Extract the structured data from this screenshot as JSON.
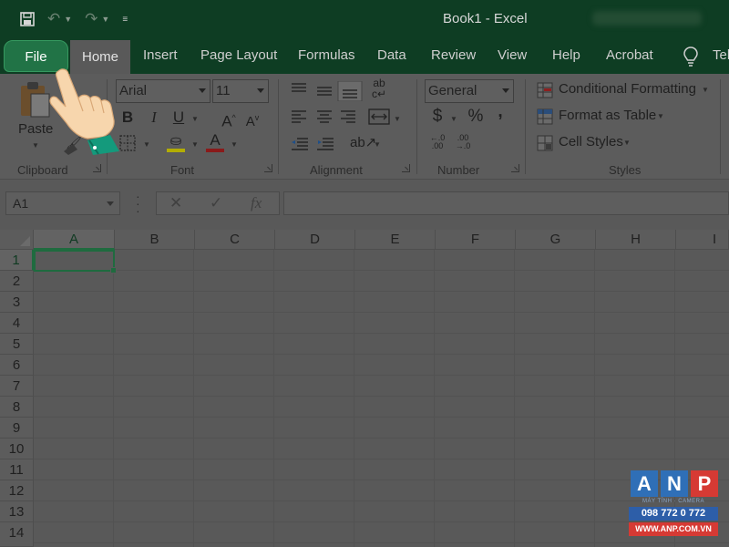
{
  "title_bar": {
    "title": "Book1  -  Excel",
    "qat": {
      "save_icon": "save-icon",
      "undo_icon": "undo-icon",
      "redo_icon": "redo-icon",
      "customize_icon": "customize-qat-icon"
    }
  },
  "tabs": {
    "file": "File",
    "home": "Home",
    "items": [
      "Insert",
      "Page Layout",
      "Formulas",
      "Data",
      "Review",
      "View",
      "Help",
      "Acrobat"
    ],
    "tell_me": "Tel",
    "tell_me_icon": "lightbulb-icon"
  },
  "ribbon": {
    "clipboard": {
      "paste_label": "Paste",
      "group_label": "Clipboard"
    },
    "font": {
      "font_name": "Arial",
      "font_size": "11",
      "bold": "B",
      "italic": "I",
      "underline": "U",
      "grow": "A",
      "shrink": "A",
      "group_label": "Font",
      "fill_color": "#e7e100",
      "font_color": "#c00000"
    },
    "alignment": {
      "group_label": "Alignment"
    },
    "number": {
      "format": "General",
      "currency": "$",
      "percent": "%",
      "comma": ",",
      "group_label": "Number"
    },
    "styles": {
      "conditional_formatting": "Conditional Formatting",
      "format_as_table": "Format as Table",
      "cell_styles": "Cell Styles",
      "group_label": "Styles"
    }
  },
  "formula_bar": {
    "name_box": "A1",
    "cancel": "✕",
    "enter": "✓",
    "fx": "fx",
    "formula": ""
  },
  "grid": {
    "columns": [
      "A",
      "B",
      "C",
      "D",
      "E",
      "F",
      "G",
      "H",
      "I"
    ],
    "rows": [
      "1",
      "2",
      "3",
      "4",
      "5",
      "6",
      "7",
      "8",
      "9",
      "10",
      "11",
      "12",
      "13",
      "14"
    ],
    "active_cell": "A1"
  },
  "watermark": {
    "letters": [
      "A",
      "N",
      "P"
    ],
    "tagline": "MÁY TÍNH · CAMERA",
    "phone": "098 772 0 772",
    "site": "WWW.ANP.COM.VN"
  },
  "colors": {
    "excel_green": "#217346",
    "title_bg": "#0e3d23",
    "selection_green": "#1f6b3f"
  }
}
